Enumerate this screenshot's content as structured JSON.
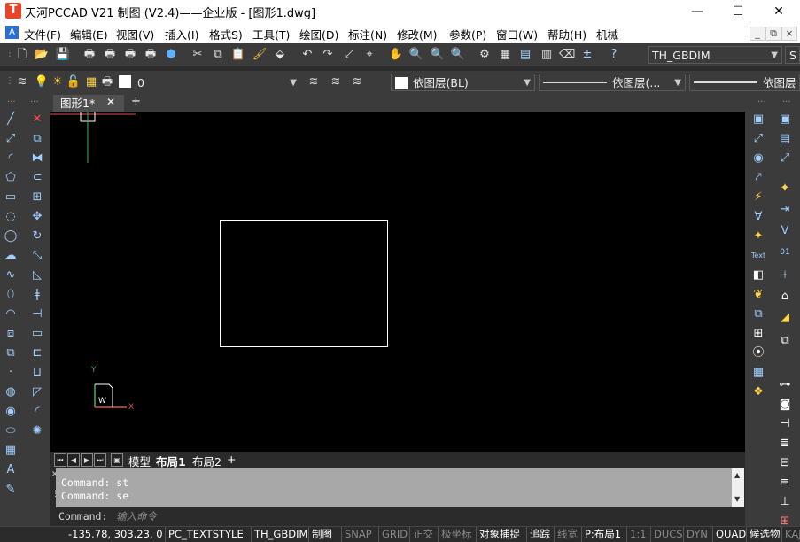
{
  "window": {
    "title": "天河PCCAD V21 制图 (V2.4)——企业版 - [图形1.dwg]",
    "logo_glyph": "T",
    "controls": {
      "minimize": "—",
      "maximize": "☐",
      "close": "✕"
    }
  },
  "menu": {
    "items": [
      "文件(F)",
      "编辑(E)",
      "视图(V)",
      "插入(I)",
      "格式S)",
      "工具(T)",
      "绘图(D)",
      "标注(N)",
      "修改(M)",
      "参数(P)",
      "窗口(W)",
      "帮助(H)",
      "机械"
    ],
    "mdi_controls": [
      "_",
      "⧉",
      "×"
    ]
  },
  "toolbar1": {
    "dimstyle_value": "TH_GBDIM",
    "text_style_partial": "S"
  },
  "toolbar2": {
    "layer_value": "0",
    "color_value": "依图层(BL)",
    "linetype_value": "依图层(...",
    "lineweight_value": "依图层"
  },
  "tabs": {
    "active_doc": "图形1*",
    "close_glyph": "✕",
    "add_glyph": "+"
  },
  "canvas": {
    "ucs_x": "X",
    "ucs_y": "Y",
    "ucs_w": "W"
  },
  "layout_tabs": {
    "items": [
      "模型",
      "布局1",
      "布局2"
    ],
    "active": "布局1",
    "add_glyph": "+"
  },
  "command": {
    "history": [
      "Command: st",
      "Command: se"
    ],
    "prompt": "Command:",
    "placeholder": "输入命令"
  },
  "status": {
    "coords": "-135.78, 303.23, 0",
    "text_style": "PC_TEXTSTYLE",
    "dim_style": "TH_GBDIM",
    "mode": "制图",
    "toggles": [
      {
        "label": "SNAP",
        "on": false
      },
      {
        "label": "GRID",
        "on": false
      },
      {
        "label": "正交",
        "on": false
      },
      {
        "label": "极坐标",
        "on": false
      },
      {
        "label": "对象捕捉",
        "on": true
      },
      {
        "label": "追踪",
        "on": true
      },
      {
        "label": "线宽",
        "on": false
      },
      {
        "label": "P:布局1",
        "on": true
      },
      {
        "label": "1:1",
        "on": false
      },
      {
        "label": "DUCS",
        "on": false
      },
      {
        "label": "DYN",
        "on": false
      },
      {
        "label": "QUAD",
        "on": true
      },
      {
        "label": "候选物",
        "on": true
      },
      {
        "label": "KAJ",
        "on": false
      }
    ]
  },
  "colors": {
    "canvas_bg": "#000000",
    "panel_bg": "#3b3b3b",
    "cmd_history_bg": "#a8a8a8",
    "accent_red": "#e8442a"
  }
}
